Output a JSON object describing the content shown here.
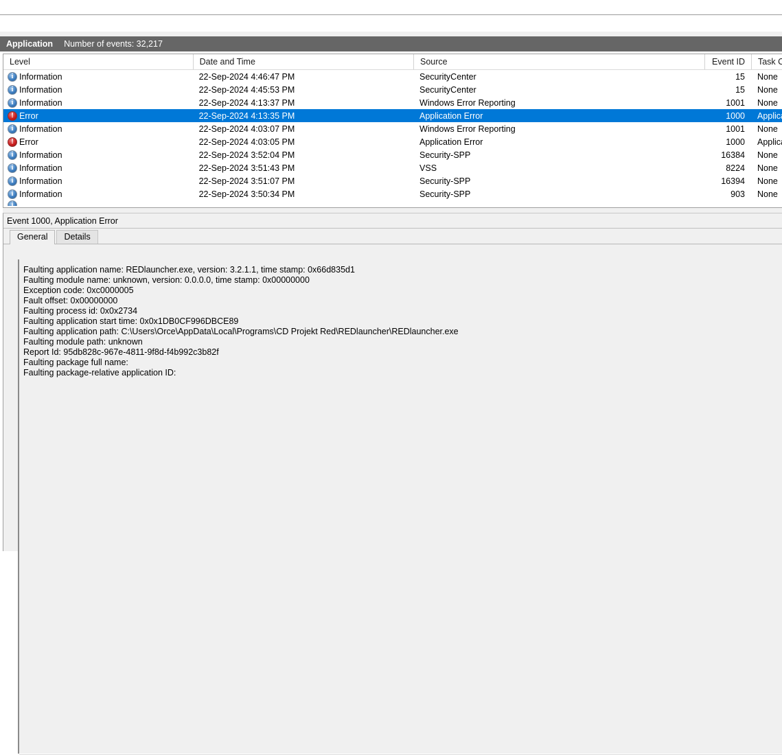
{
  "log_header": {
    "log_name": "Application",
    "event_count_label": "Number of events: 32,217"
  },
  "events_table": {
    "columns": [
      {
        "key": "level",
        "label": "Level"
      },
      {
        "key": "datetime",
        "label": "Date and Time"
      },
      {
        "key": "source",
        "label": "Source"
      },
      {
        "key": "event_id",
        "label": "Event ID"
      },
      {
        "key": "task_category",
        "label": "Task Cat"
      }
    ],
    "rows": [
      {
        "icon": "information-icon",
        "level": "Information",
        "datetime": "22-Sep-2024 4:46:47 PM",
        "source": "SecurityCenter",
        "event_id": "15",
        "task_category": "None",
        "selected": false
      },
      {
        "icon": "information-icon",
        "level": "Information",
        "datetime": "22-Sep-2024 4:45:53 PM",
        "source": "SecurityCenter",
        "event_id": "15",
        "task_category": "None",
        "selected": false
      },
      {
        "icon": "information-icon",
        "level": "Information",
        "datetime": "22-Sep-2024 4:13:37 PM",
        "source": "Windows Error Reporting",
        "event_id": "1001",
        "task_category": "None",
        "selected": false
      },
      {
        "icon": "error-icon",
        "level": "Error",
        "datetime": "22-Sep-2024 4:13:35 PM",
        "source": "Application Error",
        "event_id": "1000",
        "task_category": "Applica",
        "selected": true
      },
      {
        "icon": "information-icon",
        "level": "Information",
        "datetime": "22-Sep-2024 4:03:07 PM",
        "source": "Windows Error Reporting",
        "event_id": "1001",
        "task_category": "None",
        "selected": false
      },
      {
        "icon": "error-icon",
        "level": "Error",
        "datetime": "22-Sep-2024 4:03:05 PM",
        "source": "Application Error",
        "event_id": "1000",
        "task_category": "Applica",
        "selected": false
      },
      {
        "icon": "information-icon",
        "level": "Information",
        "datetime": "22-Sep-2024 3:52:04 PM",
        "source": "Security-SPP",
        "event_id": "16384",
        "task_category": "None",
        "selected": false
      },
      {
        "icon": "information-icon",
        "level": "Information",
        "datetime": "22-Sep-2024 3:51:43 PM",
        "source": "VSS",
        "event_id": "8224",
        "task_category": "None",
        "selected": false
      },
      {
        "icon": "information-icon",
        "level": "Information",
        "datetime": "22-Sep-2024 3:51:07 PM",
        "source": "Security-SPP",
        "event_id": "16394",
        "task_category": "None",
        "selected": false
      },
      {
        "icon": "information-icon",
        "level": "Information",
        "datetime": "22-Sep-2024 3:50:34 PM",
        "source": "Security-SPP",
        "event_id": "903",
        "task_category": "None",
        "selected": false
      }
    ]
  },
  "detail": {
    "title": "Event 1000, Application Error",
    "tabs": [
      {
        "label": "General",
        "active": true
      },
      {
        "label": "Details",
        "active": false
      }
    ],
    "lines": [
      "Faulting application name: REDlauncher.exe, version: 3.2.1.1, time stamp: 0x66d835d1",
      "Faulting module name: unknown, version: 0.0.0.0, time stamp: 0x00000000",
      "Exception code: 0xc0000005",
      "Fault offset: 0x00000000",
      "Faulting process id: 0x0x2734",
      "Faulting application start time: 0x0x1DB0CF996DBCE89",
      "Faulting application path: C:\\Users\\Orce\\AppData\\Local\\Programs\\CD Projekt Red\\REDlauncher\\REDlauncher.exe",
      "Faulting module path: unknown",
      "Report Id: 95db828c-967e-4811-9f8d-f4b992c3b82f",
      "Faulting package full name:",
      "Faulting package-relative application ID:"
    ]
  },
  "colors": {
    "selection_blue": "#0078d7",
    "log_header_gray": "#666666",
    "pane_background": "#f0f0f0",
    "error_red": "#cc1f1f",
    "info_blue": "#3f7fc1"
  }
}
